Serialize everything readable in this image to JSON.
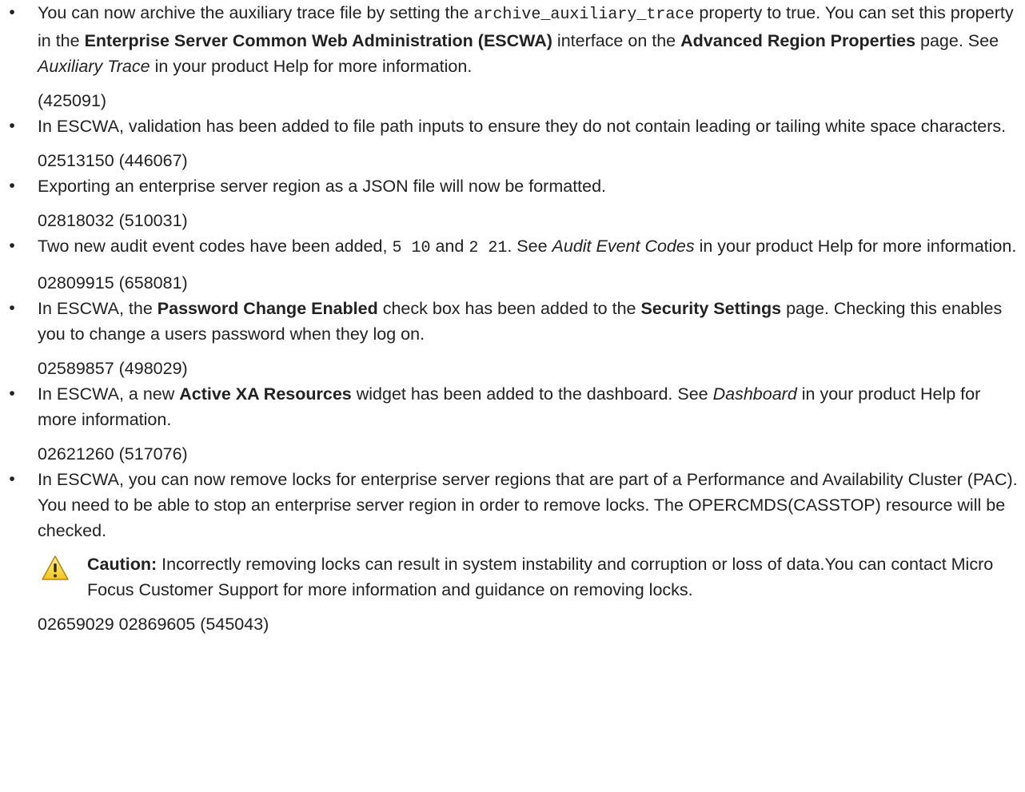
{
  "items": [
    {
      "segments": [
        {
          "t": "You can now archive the auxiliary trace file by setting the "
        },
        {
          "t": "archive_auxiliary_trace",
          "mono": true
        },
        {
          "t": " property to true. You can set this property in the "
        },
        {
          "t": "Enterprise Server Common Web Administration (ESCWA)",
          "b": true
        },
        {
          "t": " interface on the "
        },
        {
          "t": "Advanced Region Properties",
          "b": true
        },
        {
          "t": " page. See "
        },
        {
          "t": "Auxiliary Trace",
          "i": true
        },
        {
          "t": " in your product Help for more information."
        }
      ],
      "ref": "(425091)"
    },
    {
      "segments": [
        {
          "t": "In ESCWA, validation has been added to file path inputs to ensure they do not contain leading or tailing white space characters."
        }
      ],
      "ref": "02513150 (446067)"
    },
    {
      "segments": [
        {
          "t": "Exporting an enterprise server region as a JSON file will now be formatted."
        }
      ],
      "ref": "02818032 (510031)"
    },
    {
      "segments": [
        {
          "t": "Two new audit event codes have been added, "
        },
        {
          "t": "5 10",
          "mono": true
        },
        {
          "t": " and "
        },
        {
          "t": "2 21",
          "mono": true
        },
        {
          "t": ". See "
        },
        {
          "t": "Audit Event Codes",
          "i": true
        },
        {
          "t": " in your product Help for more information."
        }
      ],
      "ref": "02809915 (658081)"
    },
    {
      "segments": [
        {
          "t": "In ESCWA, the "
        },
        {
          "t": "Password Change Enabled",
          "b": true
        },
        {
          "t": " check box has been added to the "
        },
        {
          "t": "Security Settings",
          "b": true
        },
        {
          "t": " page. Checking this enables you to change a users password when they log on."
        }
      ],
      "ref": "02589857 (498029)"
    },
    {
      "segments": [
        {
          "t": "In ESCWA, a new "
        },
        {
          "t": "Active XA Resources",
          "b": true
        },
        {
          "t": " widget has been added to the dashboard. See "
        },
        {
          "t": "Dashboard",
          "i": true
        },
        {
          "t": " in your product Help for more information."
        }
      ],
      "ref": "02621260 (517076)"
    },
    {
      "segments": [
        {
          "t": "In ESCWA, you can now remove locks for enterprise server regions that are part of a Performance and Availability Cluster (PAC). You need to be able to stop an enterprise server region in order to remove locks. The OPERCMDS(CASSTOP) resource will be checked."
        }
      ],
      "caution": {
        "label": "Caution:",
        "text": " Incorrectly removing locks can result in system instability and corruption or loss of data.You can contact Micro Focus Customer Support for more information and guidance on removing locks.",
        "icon": "warning-icon"
      },
      "ref": "02659029 02869605 (545043)"
    }
  ],
  "bullet": "•"
}
